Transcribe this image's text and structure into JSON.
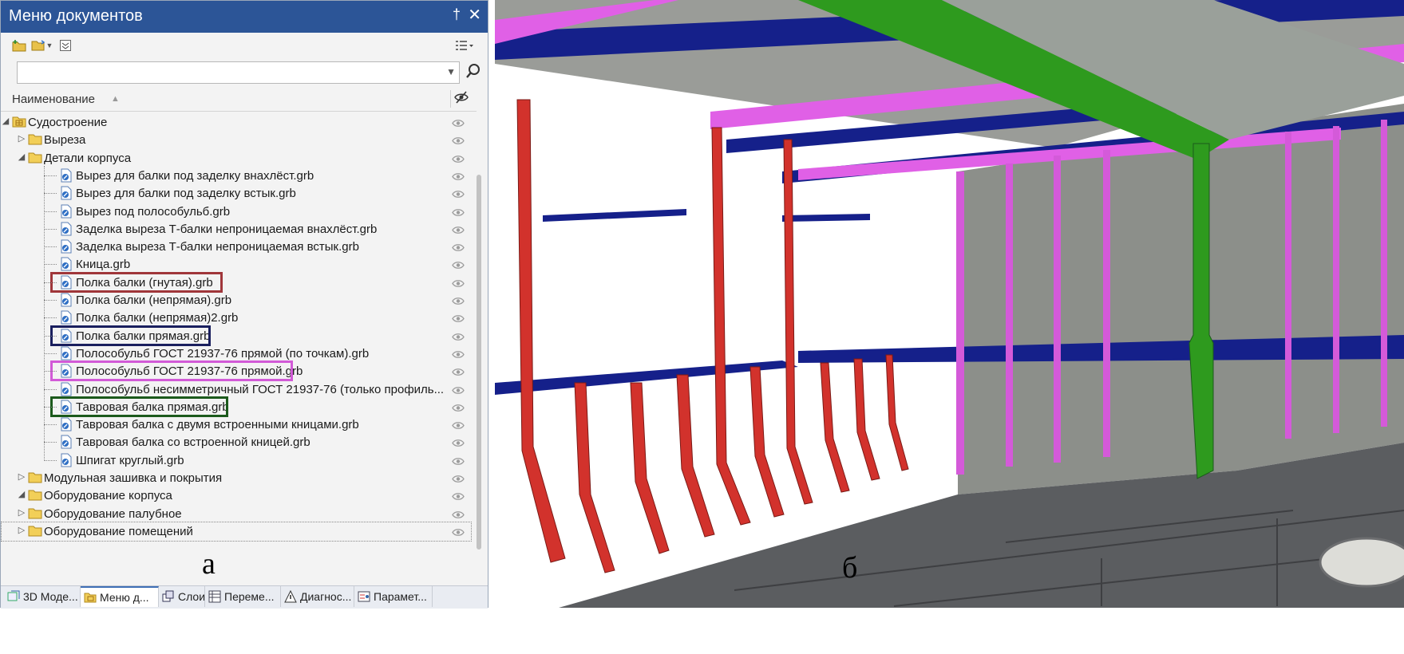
{
  "panel": {
    "title": "Меню документов",
    "pin_glyph": "†",
    "close_glyph": "✕",
    "search": {
      "value": ""
    },
    "column_header": "Наименование",
    "tree": [
      {
        "label": "Судостроение",
        "level": 0,
        "type": "folder-open-root",
        "toggle": "expanded"
      },
      {
        "label": "Выреза",
        "level": 1,
        "type": "folder",
        "toggle": "collapsed"
      },
      {
        "label": "Детали корпуса",
        "level": 1,
        "type": "folder-open",
        "toggle": "expanded"
      },
      {
        "label": "Вырез для балки под заделку внахлёст.grb",
        "level": 2,
        "type": "file"
      },
      {
        "label": "Вырез для балки под заделку встык.grb",
        "level": 2,
        "type": "file"
      },
      {
        "label": "Вырез под полособульб.grb",
        "level": 2,
        "type": "file"
      },
      {
        "label": "Заделка выреза Т-балки непроницаемая внахлёст.grb",
        "level": 2,
        "type": "file"
      },
      {
        "label": "Заделка выреза Т-балки непроницаемая встык.grb",
        "level": 2,
        "type": "file"
      },
      {
        "label": "Кница.grb",
        "level": 2,
        "type": "file"
      },
      {
        "label": "Полка балки (гнутая).grb",
        "level": 2,
        "type": "file",
        "highlight": "#a0363a"
      },
      {
        "label": "Полка балки (непрямая).grb",
        "level": 2,
        "type": "file"
      },
      {
        "label": "Полка балки (непрямая)2.grb",
        "level": 2,
        "type": "file"
      },
      {
        "label": "Полка балки прямая.grb",
        "level": 2,
        "type": "file",
        "highlight": "#1a1f5e"
      },
      {
        "label": "Полособульб ГОСТ 21937-76 прямой (по точкам).grb",
        "level": 2,
        "type": "file"
      },
      {
        "label": "Полособульб ГОСТ 21937-76 прямой.grb",
        "level": 2,
        "type": "file",
        "highlight": "#d25ad7"
      },
      {
        "label": "Полособульб несимметричный ГОСТ 21937-76 (только профиль...",
        "level": 2,
        "type": "file"
      },
      {
        "label": "Тавровая балка прямая.grb",
        "level": 2,
        "type": "file",
        "highlight": "#1c5a1c"
      },
      {
        "label": "Тавровая балка с двумя встроенными кницами.grb",
        "level": 2,
        "type": "file"
      },
      {
        "label": "Тавровая балка со встроенной кницей.grb",
        "level": 2,
        "type": "file"
      },
      {
        "label": "Шпигат круглый.grb",
        "level": 2,
        "type": "file"
      },
      {
        "label": "Модульная зашивка и покрытия",
        "level": 1,
        "type": "folder",
        "toggle": "collapsed"
      },
      {
        "label": "Оборудование корпуса",
        "level": 1,
        "type": "folder-open",
        "toggle": "expanded"
      },
      {
        "label": "Оборудование палубное",
        "level": 1,
        "type": "folder",
        "toggle": "collapsed"
      },
      {
        "label": "Оборудование помещений",
        "level": 1,
        "type": "folder",
        "toggle": "collapsed",
        "selected": true
      }
    ],
    "tabs": [
      {
        "label": "3D Моде...",
        "icon": "3d-model-icon"
      },
      {
        "label": "Меню д...",
        "icon": "document-menu-icon",
        "active": true
      },
      {
        "label": "Слои",
        "icon": "layers-icon"
      },
      {
        "label": "Переме...",
        "icon": "variables-icon"
      },
      {
        "label": "Диагнос...",
        "icon": "warning-icon"
      },
      {
        "label": "Парамет...",
        "icon": "parameters-icon"
      }
    ]
  },
  "captions": {
    "left": "а",
    "right": "б"
  },
  "colors": {
    "title_bar": "#2c5597",
    "flange_bent": "#d2322c",
    "flange_straight": "#15208a",
    "bulb_flat": "#e060e6",
    "tee_beam": "#2e9a1e",
    "hull_plate": "#8c8f8a",
    "deck": "#5b5d60"
  }
}
